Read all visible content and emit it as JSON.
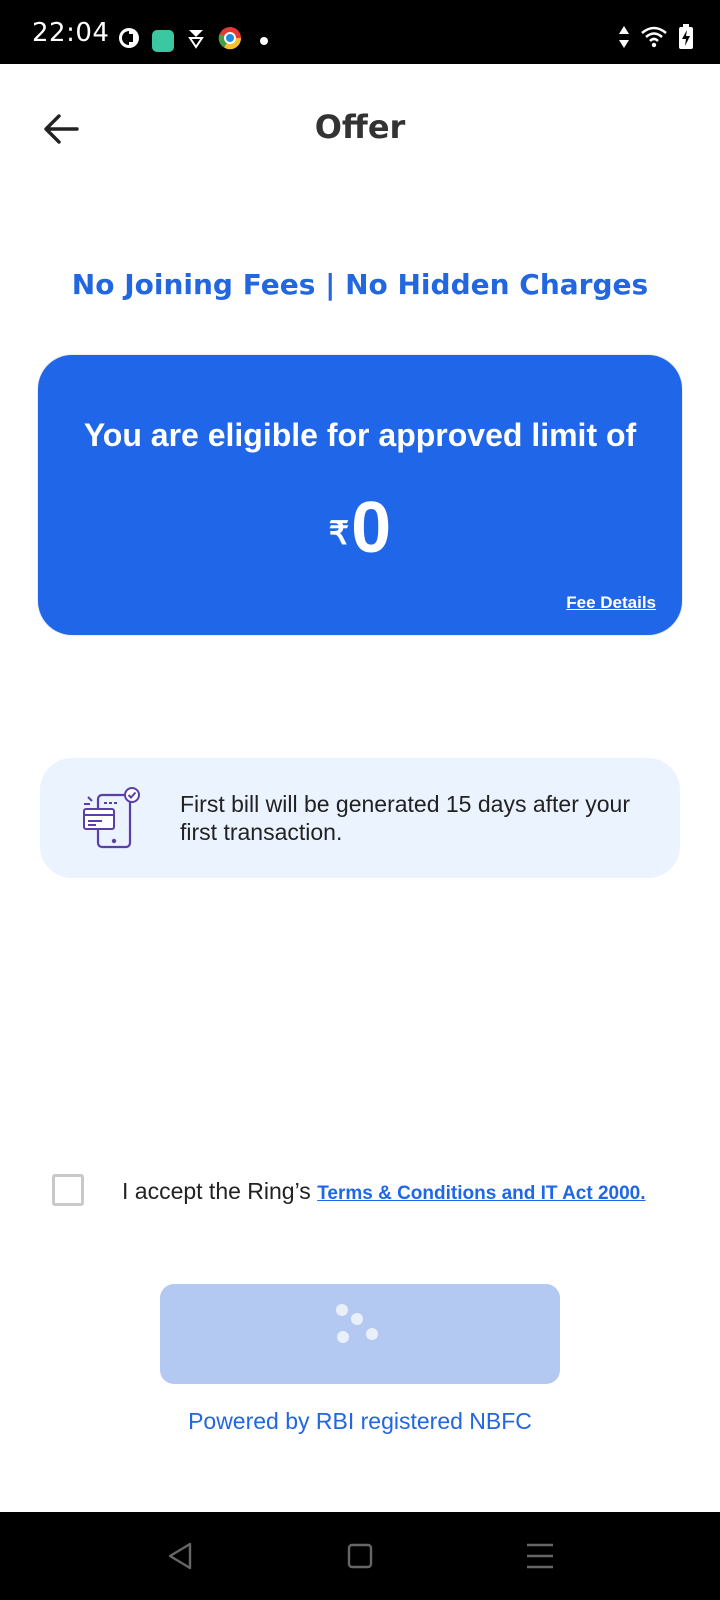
{
  "status_bar": {
    "time": "22:04",
    "icons": [
      "sync-icon",
      "app-icon",
      "cloud-icon",
      "chrome-icon",
      "notification-dot"
    ],
    "right_icons": [
      "data-arrows-icon",
      "wifi-icon",
      "battery-charging-icon"
    ]
  },
  "header": {
    "title": "Offer",
    "back_icon": "arrow-left-icon"
  },
  "tagline": "No Joining Fees | No Hidden Charges",
  "limit_card": {
    "heading": "You are eligible for approved limit of",
    "currency_symbol": "₹",
    "amount": "0",
    "fee_details": "Fee Details",
    "color": "#1f67e8"
  },
  "info": {
    "icon": "bill-phone-icon",
    "text": "First bill will be generated 15 days after your first transaction."
  },
  "terms": {
    "prefix": "I accept the Ring’s ",
    "link": "Terms & Conditions and IT Act 2000. ",
    "checked": false
  },
  "continue_button": {
    "state": "loading",
    "color": "#b3c9f1"
  },
  "footer": {
    "powered_by": "Powered by RBI registered NBFC"
  },
  "nav_bar": {
    "buttons": [
      "back-nav-icon",
      "home-nav-icon",
      "recents-nav-icon"
    ]
  }
}
